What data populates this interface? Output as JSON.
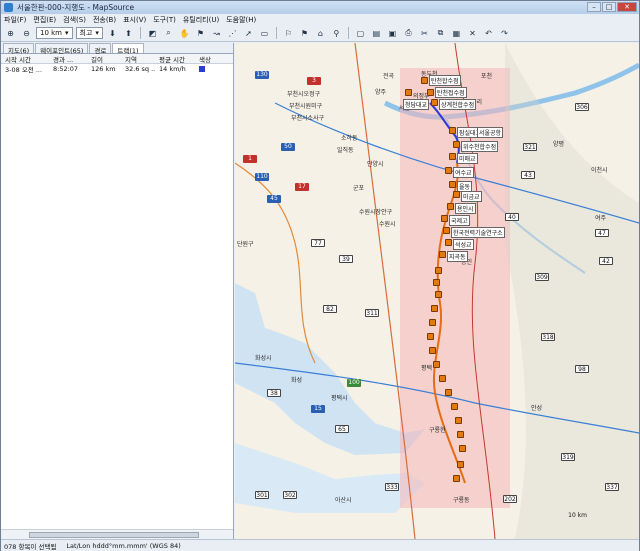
{
  "window": {
    "title": "서울한판-000-지행도 - MapSource"
  },
  "menu": [
    "파일(F)",
    "편집(E)",
    "검색(S)",
    "전송(B)",
    "표시(V)",
    "도구(T)",
    "유틸리티(U)",
    "도움말(H)"
  ],
  "toolbar": {
    "zoom_value": "10 km",
    "detail_value": "최고"
  },
  "tabs": [
    {
      "label": "지도(6)"
    },
    {
      "label": "웨이포인트(65)"
    },
    {
      "label": "경로"
    },
    {
      "label": "트랙(1)"
    }
  ],
  "track_table": {
    "columns": [
      "시작 시간",
      "경과 ...",
      "길이",
      "지역",
      "평균 시간",
      "색상"
    ],
    "rows": [
      {
        "start": "3-08 오전 ...",
        "elapsed": "8:52:07",
        "length": "126 km",
        "area": "32.6 sq ...",
        "avg": "14 km/h"
      }
    ]
  },
  "map": {
    "labels": [
      "전곡",
      "동두천",
      "양주",
      "포천",
      "의정부",
      "구리",
      "서울",
      "부천시오정구",
      "부천시원미구",
      "부천시소사구",
      "소하동",
      "일직동",
      "안양시",
      "군포",
      "수원시장안구",
      "수원시",
      "화성",
      "평택",
      "평택시",
      "화성시",
      "양평",
      "아산시",
      "여주",
      "이천시",
      "안성",
      "단원구",
      "용인",
      "구룡동",
      "구룡현"
    ],
    "waypoints": [
      "탄천합수점",
      "탄천접수점",
      "상계천합수점",
      "청담대교",
      "잠실대교",
      "서울공항",
      "위수천합수점",
      "미매교",
      "여수교",
      "율동",
      "미금교",
      "용인시",
      "국제고",
      "한국전력기술연구소",
      "석성교",
      "지곡동"
    ],
    "highway_shields": [
      "1",
      "3",
      "15",
      "17",
      "38",
      "39",
      "40",
      "42",
      "43",
      "45",
      "47",
      "50",
      "65",
      "77",
      "82",
      "98",
      "100",
      "110",
      "130",
      "202",
      "301",
      "302",
      "306",
      "309",
      "311",
      "318",
      "319",
      "321",
      "333",
      "337"
    ],
    "scale_text": "10 km"
  },
  "status": {
    "left": "078 항목이 선택됨",
    "coords": "Lat/Lon hddd°mm.mmm' (WGS 84)"
  }
}
